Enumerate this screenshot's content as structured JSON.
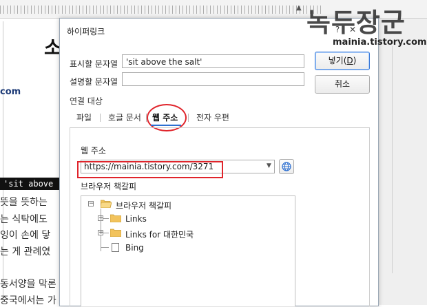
{
  "background_document": {
    "heading": "소",
    "link_fragment": "com",
    "highlight_text": "'sit above",
    "lines": [
      "뜻을 뜻하는",
      "는 식탁에도 ",
      "잉이 손에 닿",
      "는 게 관례였",
      "동서양을 막론",
      "중국에서는 가"
    ]
  },
  "watermark": {
    "title": "녹두장군",
    "url": "mainia.tistory.com"
  },
  "dialog": {
    "title": "하이퍼링크",
    "title_icons": [
      "help-icon",
      "close-icon"
    ],
    "display_text_label": "표시할 문자열",
    "display_text_value": "'sit above the salt'",
    "description_label": "설명할 문자열",
    "description_value": "",
    "insert_button_label": "넣기(",
    "insert_button_key": "D",
    "insert_button_suffix": ")",
    "cancel_button_label": "취소",
    "link_target_label": "연결 대상",
    "tabs": [
      {
        "label": "파일",
        "active": false
      },
      {
        "label": "호글 문서",
        "active": false
      },
      {
        "label": "웹 주소",
        "active": true
      },
      {
        "label": "전자 우편",
        "active": false
      }
    ],
    "web_address_label": "웹 주소",
    "web_address_value": "https://mainia.tistory.com/3271",
    "bookmarks_label": "브라우저 책갈피",
    "tree": {
      "root": "브라우저 책갈피",
      "children": [
        "Links",
        "Links for 대한민국",
        "Bing"
      ]
    },
    "accent_color": "#2c6fd1",
    "annotation_color": "#e0242b"
  }
}
